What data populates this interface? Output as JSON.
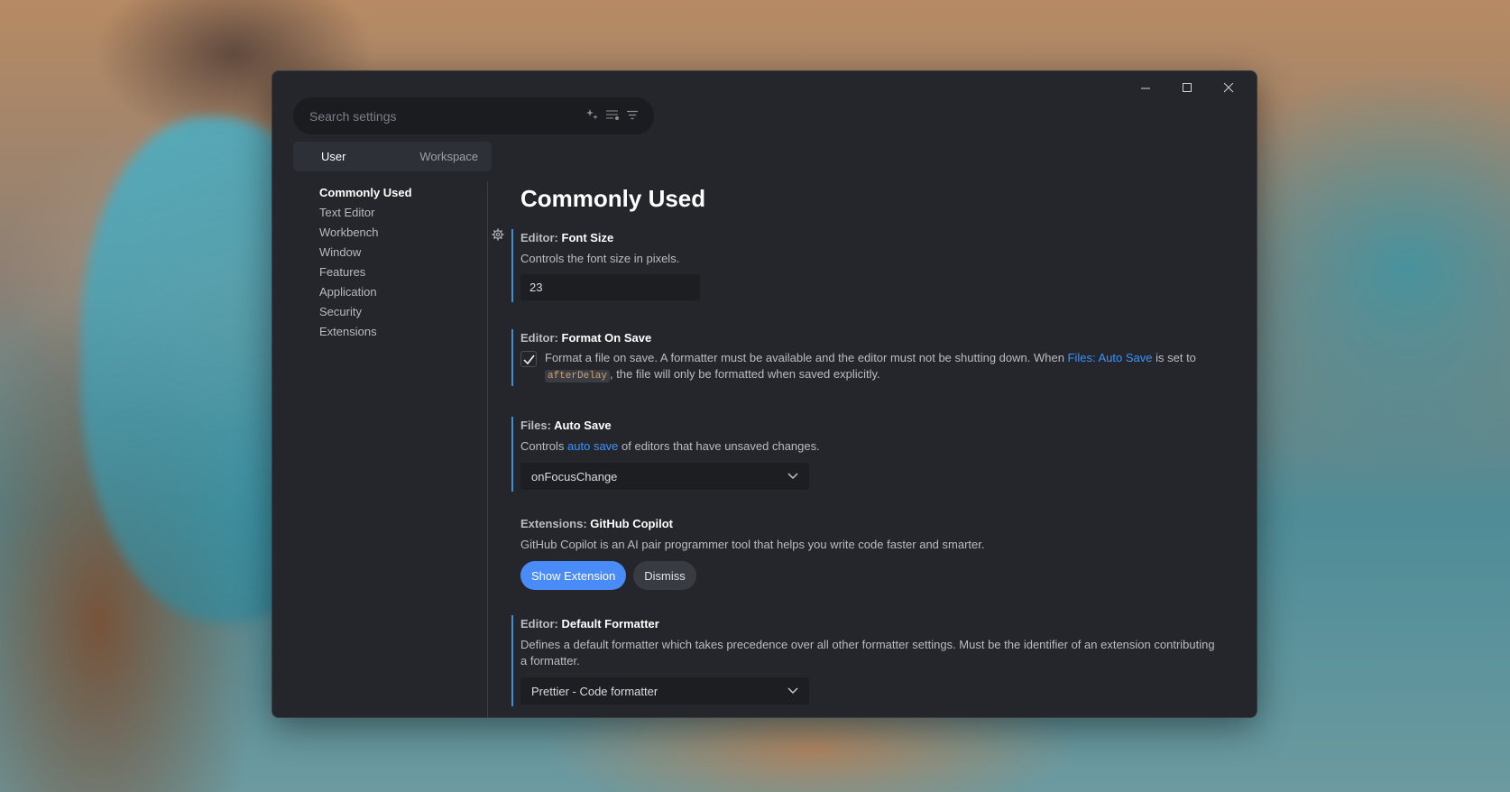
{
  "window": {
    "controls": {
      "minimize": "–",
      "maximize": "☐",
      "close": "✕"
    }
  },
  "search": {
    "placeholder": "Search settings"
  },
  "scope_tabs": [
    {
      "label": "User",
      "active": true
    },
    {
      "label": "Workspace",
      "active": false
    }
  ],
  "toc": [
    "Commonly Used",
    "Text Editor",
    "Workbench",
    "Window",
    "Features",
    "Application",
    "Security",
    "Extensions"
  ],
  "page_title": "Commonly Used",
  "settings": {
    "font_size": {
      "category": "Editor: ",
      "name": "Font Size",
      "description": "Controls the font size in pixels.",
      "value": "23"
    },
    "format_on_save": {
      "category": "Editor: ",
      "name": "Format On Save",
      "desc_1": "Format a file on save. A formatter must be available and the editor must not be shutting down. When ",
      "link": "Files: Auto Save",
      "desc_2": " is set to ",
      "code": "afterDelay",
      "desc_3": ", the file will only be formatted when saved explicitly.",
      "checked": true
    },
    "auto_save": {
      "category": "Files: ",
      "name": "Auto Save",
      "desc_1": "Controls ",
      "link": "auto save",
      "desc_2": " of editors that have unsaved changes.",
      "value": "onFocusChange"
    },
    "copilot": {
      "category": "Extensions: ",
      "name": "GitHub Copilot",
      "description": "GitHub Copilot is an AI pair programmer tool that helps you write code faster and smarter.",
      "primary_button": "Show Extension",
      "secondary_button": "Dismiss"
    },
    "default_formatter": {
      "category": "Editor: ",
      "name": "Default Formatter",
      "description": "Defines a default formatter which takes precedence over all other formatter settings. Must be the identifier of an extension contributing a formatter.",
      "value": "Prettier - Code formatter"
    }
  },
  "icons": {
    "ai_search": "sparkle-icon",
    "filter_list": "list-filter-icon",
    "filter": "filter-icon",
    "gear": "gear-icon",
    "chevron": "chevron-down-icon",
    "check": "check-icon"
  },
  "colors": {
    "window_bg": "#24262c",
    "accent_link": "#3794ff",
    "primary_button": "#4a8cf7",
    "modified_bar": "#3c8fd6"
  }
}
